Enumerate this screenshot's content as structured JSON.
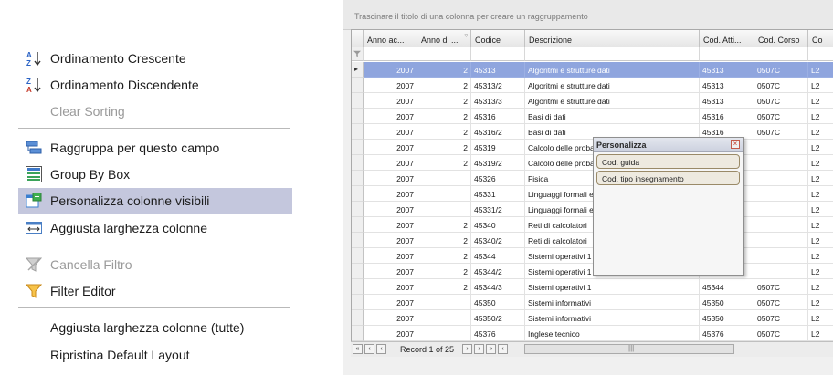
{
  "menu": {
    "items": [
      {
        "label": "Ordinamento Crescente",
        "icon": "sort-ascending-icon"
      },
      {
        "label": "Ordinamento Discendente",
        "icon": "sort-descending-icon"
      },
      {
        "label": "Clear Sorting",
        "disabled": true
      },
      {
        "label": "Raggruppa per questo campo",
        "icon": "group-by-field-icon"
      },
      {
        "label": "Group By Box",
        "icon": "group-by-box-icon"
      },
      {
        "label": "Personalizza colonne visibili",
        "icon": "column-chooser-icon",
        "highlighted": true
      },
      {
        "label": "Aggiusta larghezza colonne",
        "icon": "best-fit-icon"
      },
      {
        "label": "Cancella Filtro",
        "icon": "clear-filter-icon",
        "disabled": true
      },
      {
        "label": "Filter Editor",
        "icon": "filter-icon"
      },
      {
        "label": "Aggiusta larghezza colonne (tutte)"
      },
      {
        "label": "Ripristina Default Layout"
      }
    ],
    "highlight_color": "#c4c7dd"
  },
  "grid": {
    "group_panel_text": "Trascinare il titolo di una colonna per creare un raggruppamento",
    "columns": [
      "Anno ac...",
      "Anno di ...",
      "Codice",
      "Descrizione",
      "Cod. Atti...",
      "Cod. Corso",
      "Co"
    ],
    "rows": [
      [
        "2007",
        "2",
        "45313",
        "Algoritmi e strutture dati",
        "45313",
        "0507C",
        "L2"
      ],
      [
        "2007",
        "2",
        "45313/2",
        "Algoritmi e strutture dati",
        "45313",
        "0507C",
        "L2"
      ],
      [
        "2007",
        "2",
        "45313/3",
        "Algoritmi e strutture dati",
        "45313",
        "0507C",
        "L2"
      ],
      [
        "2007",
        "2",
        "45316",
        "Basi di dati",
        "45316",
        "0507C",
        "L2"
      ],
      [
        "2007",
        "2",
        "45316/2",
        "Basi di dati",
        "45316",
        "0507C",
        "L2"
      ],
      [
        "2007",
        "2",
        "45319",
        "Calcolo delle proba",
        "",
        "",
        "L2"
      ],
      [
        "2007",
        "2",
        "45319/2",
        "Calcolo delle proba",
        "",
        "",
        "L2"
      ],
      [
        "2007",
        "",
        "45326",
        "Fisica",
        "",
        "",
        "L2"
      ],
      [
        "2007",
        "",
        "45331",
        "Linguaggi formali e",
        "",
        "",
        "L2"
      ],
      [
        "2007",
        "",
        "45331/2",
        "Linguaggi formali e",
        "",
        "",
        "L2"
      ],
      [
        "2007",
        "2",
        "45340",
        "Reti di calcolatori",
        "",
        "",
        "L2"
      ],
      [
        "2007",
        "2",
        "45340/2",
        "Reti di calcolatori",
        "",
        "",
        "L2"
      ],
      [
        "2007",
        "2",
        "45344",
        "Sistemi operativi 1",
        "",
        "",
        "L2"
      ],
      [
        "2007",
        "2",
        "45344/2",
        "Sistemi operativi 1",
        "",
        "",
        "L2"
      ],
      [
        "2007",
        "2",
        "45344/3",
        "Sistemi operativi 1",
        "45344",
        "0507C",
        "L2"
      ],
      [
        "2007",
        "",
        "45350",
        "Sistemi informativi",
        "45350",
        "0507C",
        "L2"
      ],
      [
        "2007",
        "",
        "45350/2",
        "Sistemi informativi",
        "45350",
        "0507C",
        "L2"
      ],
      [
        "2007",
        "",
        "45376",
        "Inglese tecnico",
        "45376",
        "0507C",
        "L2"
      ]
    ],
    "selected_row": 0,
    "selection_color": "#8fa5de",
    "navigator": {
      "record_text": "Record 1 of 25"
    }
  },
  "popup": {
    "title": "Personalizza",
    "items": [
      "Cod. guida",
      "Cod. tipo insegnamento"
    ]
  }
}
